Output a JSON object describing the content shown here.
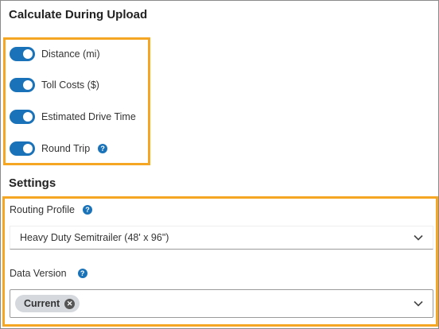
{
  "upload": {
    "title": "Calculate During Upload",
    "toggles": [
      {
        "label": "Distance (mi)",
        "on": true
      },
      {
        "label": "Toll Costs ($)",
        "on": true
      },
      {
        "label": "Estimated Drive Time",
        "on": true
      },
      {
        "label": "Round Trip",
        "on": true
      }
    ],
    "help_glyph": "?"
  },
  "settings": {
    "title": "Settings",
    "routing_profile": {
      "label": "Routing Profile",
      "value": "Heavy Duty Semitrailer (48' x 96\")"
    },
    "data_version": {
      "label": "Data Version",
      "chip": "Current"
    }
  },
  "colors": {
    "accent": "#1a73b8",
    "highlight": "#f5a623"
  },
  "icons": {
    "help": "help-icon",
    "chevron": "chevron-down-icon",
    "chip_remove": "close-icon"
  }
}
